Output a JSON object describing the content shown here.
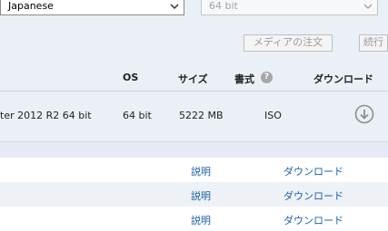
{
  "filters": {
    "language": "Japanese",
    "architecture": "64 bit"
  },
  "buttons": {
    "order_media": "メディアの注文",
    "continue": "続行"
  },
  "table": {
    "headers": {
      "os": "OS",
      "size": "サイズ",
      "format": "書式",
      "format_help": "?",
      "download": "ダウンロード"
    },
    "row": {
      "name": "ter 2012 R2 64 bit",
      "os": "64 bit",
      "size": "5222 MB",
      "format": "ISO"
    }
  },
  "list": [
    {
      "description": "説明",
      "download": "ダウンロード"
    },
    {
      "description": "説明",
      "download": "ダウンロード"
    },
    {
      "description": "説明",
      "download": "ダウンロード"
    }
  ]
}
